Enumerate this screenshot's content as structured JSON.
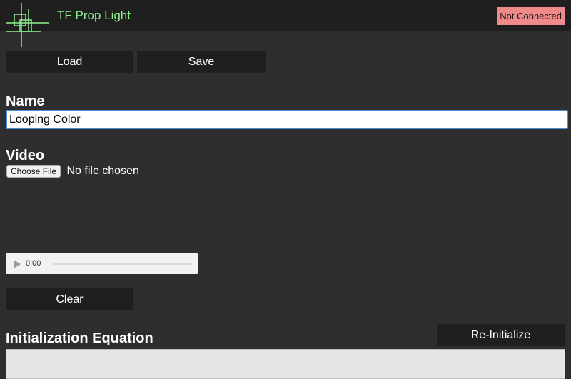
{
  "header": {
    "app_title": "TF Prop Light",
    "connection_status": "Not Connected",
    "logo_icon": "crosshair-squares-logo",
    "accent_color": "#8ff08f",
    "status_color": "#f08a8a"
  },
  "toolbar": {
    "load_label": "Load",
    "save_label": "Save"
  },
  "name_section": {
    "heading": "Name",
    "value": "Looping Color"
  },
  "video_section": {
    "heading": "Video",
    "choose_file_label": "Choose File",
    "file_status": "No file chosen",
    "audio_time": "0:00",
    "audio_progress": 0,
    "clear_label": "Clear"
  },
  "equation_section": {
    "heading": "Initialization Equation",
    "reinitialize_label": "Re-Initialize"
  }
}
